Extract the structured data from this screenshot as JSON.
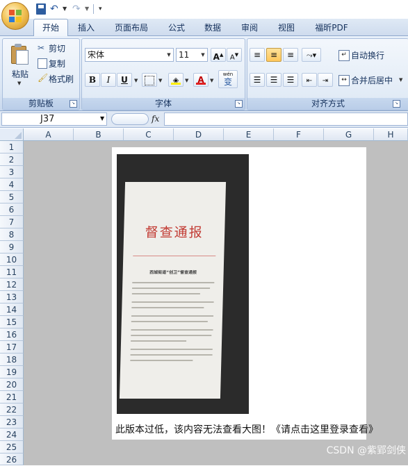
{
  "quick_access": {
    "undo_icon": "undo-icon",
    "redo_icon": "redo-icon",
    "save_icon": "save-icon"
  },
  "ribbon_tabs": [
    "开始",
    "插入",
    "页面布局",
    "公式",
    "数据",
    "审阅",
    "视图",
    "福昕PDF"
  ],
  "active_tab": "开始",
  "clipboard": {
    "paste_label": "粘贴",
    "cut_label": "剪切",
    "copy_label": "复制",
    "format_painter_label": "格式刷",
    "group_label": "剪贴板"
  },
  "font": {
    "font_name": "宋体",
    "font_size": "11",
    "grow_label": "A",
    "shrink_label": "A",
    "bold_label": "B",
    "italic_label": "I",
    "underline_label": "U",
    "font_color_label": "A",
    "phonetic_label": "wén",
    "phonetic_char": "变",
    "group_label": "字体"
  },
  "alignment": {
    "wrap_text_label": "自动换行",
    "merge_center_label": "合并后居中",
    "group_label": "对齐方式"
  },
  "formula_bar": {
    "name_box": "J37",
    "fx_label": "fx",
    "formula": ""
  },
  "sheet": {
    "columns": [
      "A",
      "B",
      "C",
      "D",
      "E",
      "F",
      "G",
      "H"
    ],
    "rows": [
      "1",
      "2",
      "3",
      "4",
      "5",
      "6",
      "7",
      "8",
      "9",
      "10",
      "11",
      "12",
      "13",
      "14",
      "15",
      "16",
      "17",
      "18",
      "19",
      "20",
      "21",
      "22",
      "23",
      "24",
      "25",
      "26"
    ]
  },
  "embedded_image": {
    "doc_title": "督查通报",
    "doc_subtitle": "西城街道“创卫”督查通报",
    "notice": "此版本过低，该内容无法查看大图！《请点击这里登录查看》"
  },
  "watermark": "CSDN @紫郢剑侠",
  "colors": {
    "ribbon_bg": "#dbe6f4",
    "sheet_bg": "#bfbfbf",
    "doc_title_red": "#c23a33",
    "highlight": "#ffc75a"
  }
}
